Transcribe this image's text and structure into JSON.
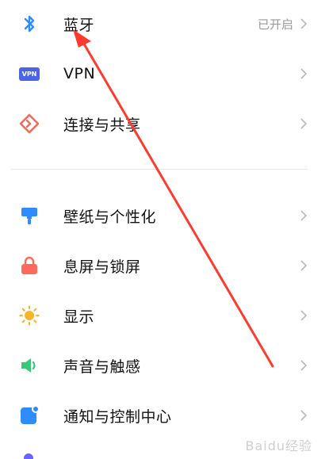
{
  "settings": {
    "group1": [
      {
        "label": "蓝牙",
        "value": "已开启",
        "icon": "bluetooth-icon",
        "color": "#2f8cff"
      },
      {
        "label": "VPN",
        "icon": "vpn-icon",
        "icon_text": "VPN",
        "color": "#4b63e6"
      },
      {
        "label": "连接与共享",
        "icon": "connection-sharing-icon",
        "color": "#f06b5a"
      }
    ],
    "group2": [
      {
        "label": "壁纸与个性化",
        "icon": "wallpaper-icon",
        "color": "#2f8cff"
      },
      {
        "label": "息屏与锁屏",
        "icon": "lock-icon",
        "color": "#ff6b5a"
      },
      {
        "label": "显示",
        "icon": "sun-icon",
        "color": "#f6b62b"
      },
      {
        "label": "声音与触感",
        "icon": "speaker-icon",
        "color": "#38c87a"
      },
      {
        "label": "通知与控制中心",
        "icon": "notification-icon",
        "color": "#2f8cff"
      }
    ]
  },
  "watermark": "Baidu经验",
  "annotation_color": "#ff3b30"
}
